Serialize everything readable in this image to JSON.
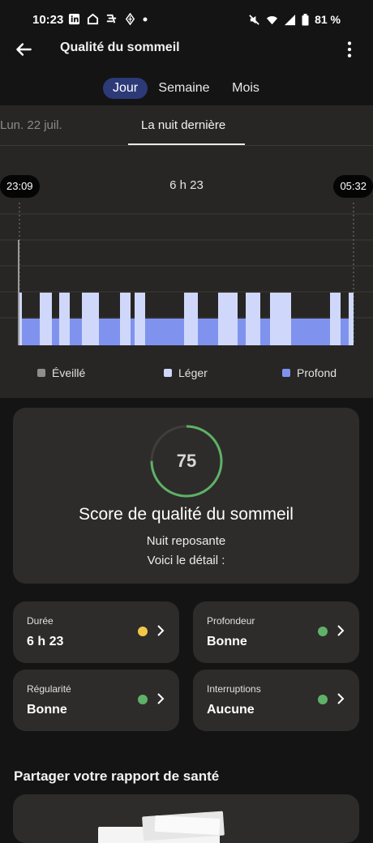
{
  "status_bar": {
    "time": "10:23",
    "battery": "81 %"
  },
  "app_bar": {
    "title": "Qualité du sommeil"
  },
  "segments": [
    "Jour",
    "Semaine",
    "Mois"
  ],
  "day_tabs": {
    "previous": "Lun. 22 juil.",
    "current": "La nuit dernière"
  },
  "graph": {
    "start_time": "23:09",
    "end_time": "05:32",
    "duration": "6 h 23",
    "legend": [
      {
        "label": "Éveillé",
        "color": "#8e8e8e"
      },
      {
        "label": "Léger",
        "color": "#cfd8fb"
      },
      {
        "label": "Profond",
        "color": "#7f93ee"
      }
    ]
  },
  "score": {
    "value": "75",
    "fraction": 0.75,
    "title": "Score de qualité du sommeil",
    "summary": "Nuit reposante",
    "detail": "Voici le détail :"
  },
  "metrics": [
    {
      "label": "Durée",
      "value": "6 h 23",
      "dot_color": "#f3c64a"
    },
    {
      "label": "Profondeur",
      "value": "Bonne",
      "dot_color": "#5fb167"
    },
    {
      "label": "Régularité",
      "value": "Bonne",
      "dot_color": "#5fb167"
    },
    {
      "label": "Interruptions",
      "value": "Aucune",
      "dot_color": "#5fb167"
    }
  ],
  "share": {
    "title": "Partager votre rapport de santé"
  }
}
